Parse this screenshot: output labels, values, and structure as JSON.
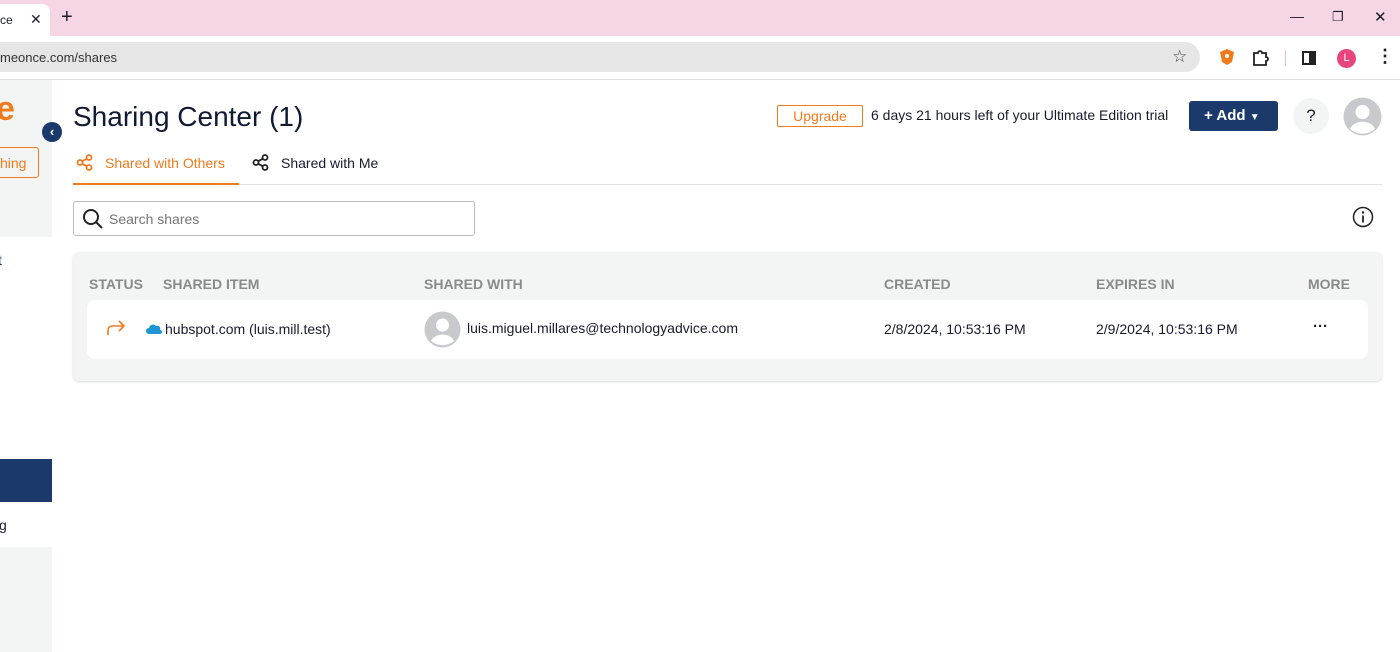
{
  "browser": {
    "tab_title": "ce",
    "url": "meonce.com/shares",
    "profile_initial": "L"
  },
  "sidebar": {
    "logo_text": "e",
    "button_label": "hing",
    "item1": "t",
    "item2": "g"
  },
  "header": {
    "title": "Sharing Center (1)",
    "upgrade_label": "Upgrade",
    "trial_text": "6 days 21 hours left of your Ultimate Edition trial",
    "add_label": "+ Add",
    "help_label": "?"
  },
  "tabs": [
    {
      "label": "Shared with Others",
      "active": true
    },
    {
      "label": "Shared with Me",
      "active": false
    }
  ],
  "search": {
    "placeholder": "Search shares",
    "value": ""
  },
  "table": {
    "columns": [
      "STATUS",
      "SHARED ITEM",
      "SHARED WITH",
      "CREATED",
      "EXPIRES IN",
      "MORE"
    ],
    "rows": [
      {
        "item": "hubspot.com (luis.mill.test)",
        "shared_with": "luis.miguel.millares@technologyadvice.com",
        "created": "2/8/2024, 10:53:16 PM",
        "expires": "2/9/2024, 10:53:16 PM",
        "more": "···"
      }
    ]
  },
  "colors": {
    "accent": "#f07b1d",
    "navy": "#1b3a6b",
    "tabbar": "#f6d5e5"
  }
}
